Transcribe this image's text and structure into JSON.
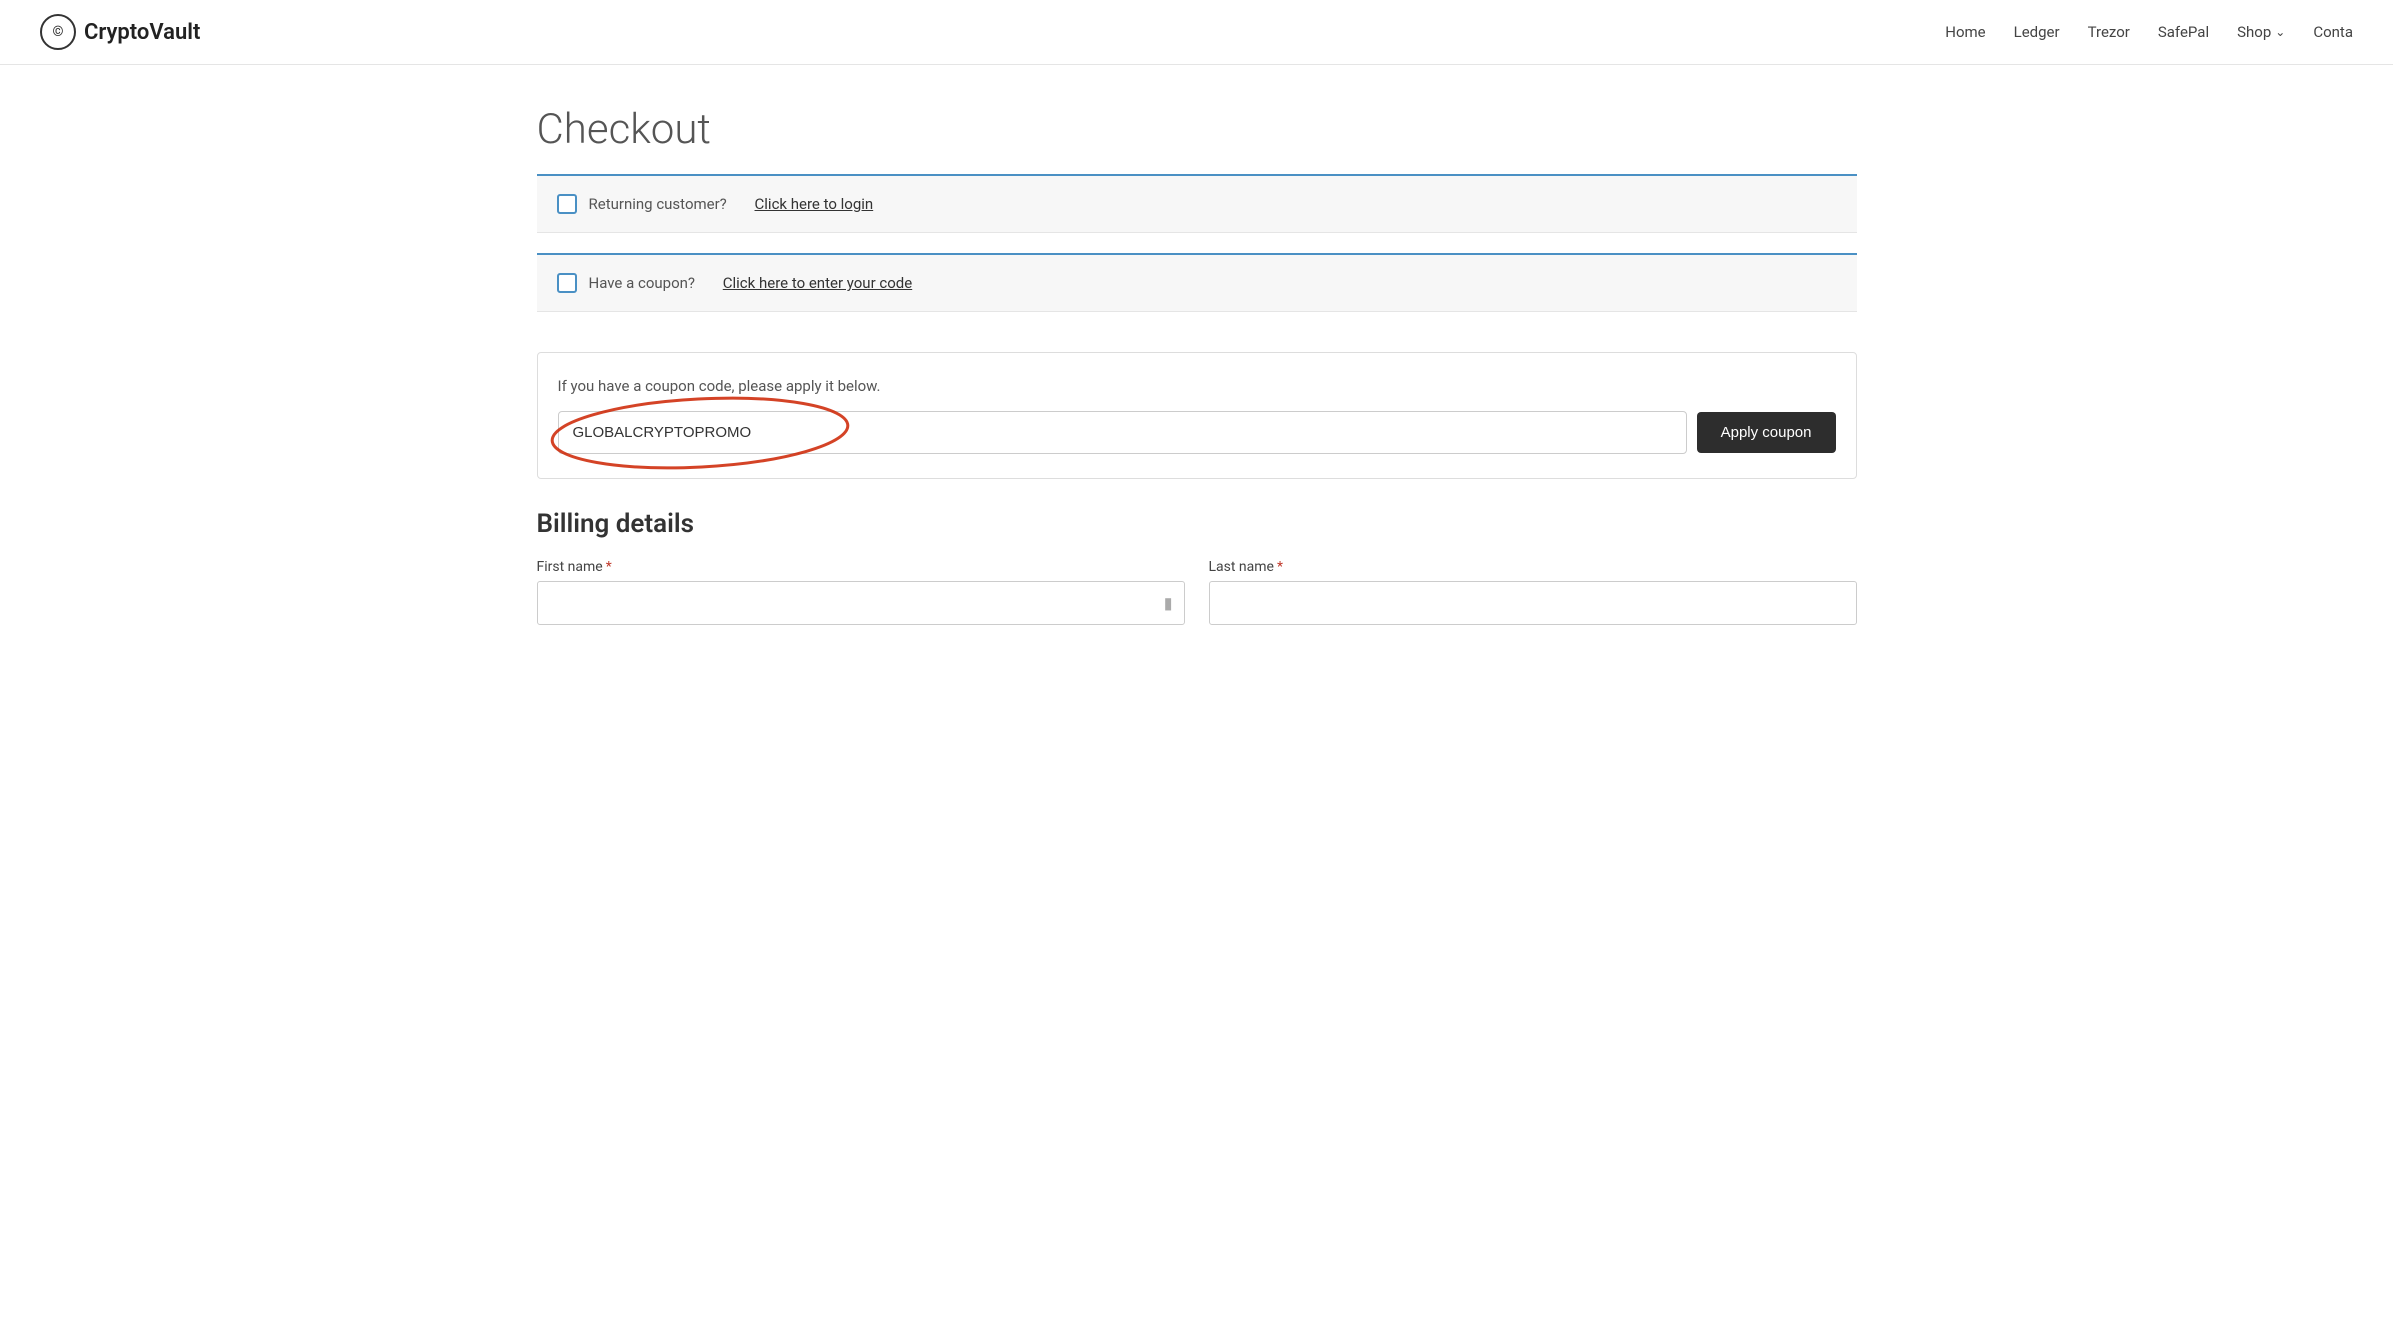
{
  "site": {
    "logo_text": "CryptoVault",
    "logo_symbol": "©"
  },
  "nav": {
    "items": [
      {
        "label": "Home",
        "href": "#"
      },
      {
        "label": "Ledger",
        "href": "#"
      },
      {
        "label": "Trezor",
        "href": "#"
      },
      {
        "label": "SafePal",
        "href": "#"
      },
      {
        "label": "Shop",
        "href": "#",
        "has_dropdown": true
      },
      {
        "label": "Conta",
        "href": "#"
      }
    ]
  },
  "page": {
    "title": "Checkout"
  },
  "notices": {
    "returning_customer_text": "Returning customer?",
    "returning_customer_link": "Click here to login",
    "coupon_text": "Have a coupon?",
    "coupon_link": "Click here to enter your code"
  },
  "coupon_section": {
    "description": "If you have a coupon code, please apply it below.",
    "input_value": "GLOBALCRYPTOPROMO",
    "input_placeholder": "",
    "button_label": "Apply coupon"
  },
  "billing": {
    "title": "Billing details",
    "first_name_label": "First name",
    "last_name_label": "Last name",
    "required_symbol": "*"
  },
  "colors": {
    "blue_accent": "#4a90c4",
    "red_annotation": "#cc2200",
    "dark_button": "#2d2d2d"
  }
}
